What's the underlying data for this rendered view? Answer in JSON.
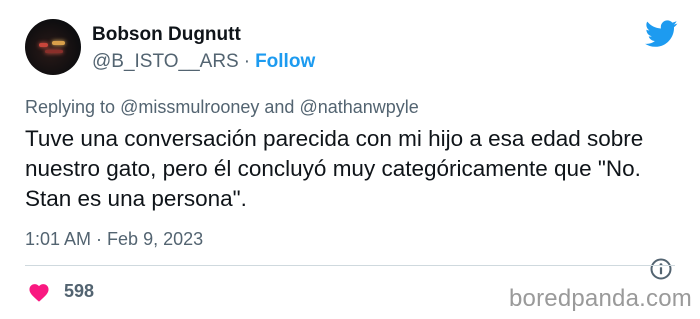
{
  "author": {
    "display_name": "Bobson Dugnutt",
    "handle": "@B_ISTO__ARS",
    "separator": "·",
    "follow_label": "Follow"
  },
  "reply": {
    "prefix": "Replying to",
    "mention_1": "@missmulrooney",
    "connector": "and",
    "mention_2": "@nathanwpyle"
  },
  "tweet": {
    "text": "Tuve una conversación parecida con mi hijo a esa edad sobre nuestro gato, pero él concluyó muy categóricamente que \"No. Stan es una persona\".",
    "time": "1:01 AM",
    "separator": "·",
    "date": "Feb 9, 2023"
  },
  "engagement": {
    "likes": "598"
  },
  "watermark": "boredpanda.com",
  "colors": {
    "twitter_blue": "#1d9bf0",
    "heart_pink": "#f91880",
    "secondary_text": "#536471"
  },
  "icons": {
    "brand": "twitter-bird-icon",
    "info": "info-icon",
    "like": "heart-icon"
  }
}
